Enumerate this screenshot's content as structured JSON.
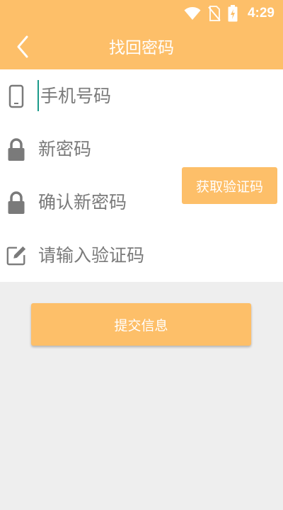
{
  "status_bar": {
    "time": "4:29",
    "icons": [
      "wifi-icon",
      "no-sim-icon",
      "battery-charging-icon"
    ]
  },
  "header": {
    "title": "找回密码",
    "back_icon": "chevron-left-icon"
  },
  "form": {
    "phone": {
      "placeholder": "手机号码",
      "icon": "phone-icon"
    },
    "new_password": {
      "placeholder": "新密码",
      "icon": "lock-icon"
    },
    "confirm_password": {
      "placeholder": "确认新密码",
      "icon": "lock-icon"
    },
    "verification_code": {
      "placeholder": "请输入验证码",
      "icon": "edit-icon"
    },
    "get_code_label": "获取验证码"
  },
  "submit_label": "提交信息",
  "colors": {
    "accent": "#fdbf69",
    "background": "#eeeeee",
    "icon_gray": "#7a7a7a",
    "cursor": "#1a9a8a"
  }
}
